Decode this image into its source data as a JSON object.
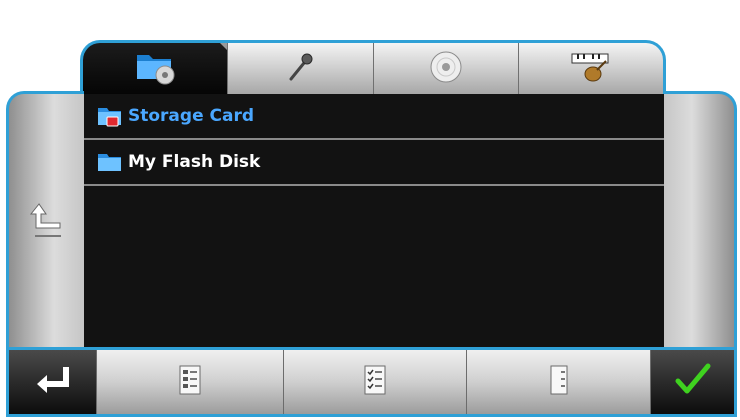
{
  "tabs": [
    {
      "icon": "folder-disc-icon",
      "active": true
    },
    {
      "icon": "microphone-icon",
      "active": false
    },
    {
      "icon": "cd-icon",
      "active": false
    },
    {
      "icon": "piano-guitar-icon",
      "active": false
    }
  ],
  "files": [
    {
      "label": "Storage Card",
      "icon": "storage-card-folder-icon",
      "selected": true
    },
    {
      "label": "My Flash Disk",
      "icon": "folder-icon",
      "selected": false
    }
  ],
  "side_left": {
    "icon": "up-arrow-icon"
  },
  "toolbar": [
    {
      "icon": "enter-back-icon"
    },
    {
      "icon": "checklist-icon"
    },
    {
      "icon": "checklist-all-icon"
    },
    {
      "icon": "list-uncheck-icon"
    },
    {
      "icon": "checkmark-icon"
    }
  ],
  "colors": {
    "frame_accent": "#2fa0d6",
    "selected_text": "#4aa7ff",
    "list_background": "#121212",
    "confirm_check": "#3fd21f"
  }
}
